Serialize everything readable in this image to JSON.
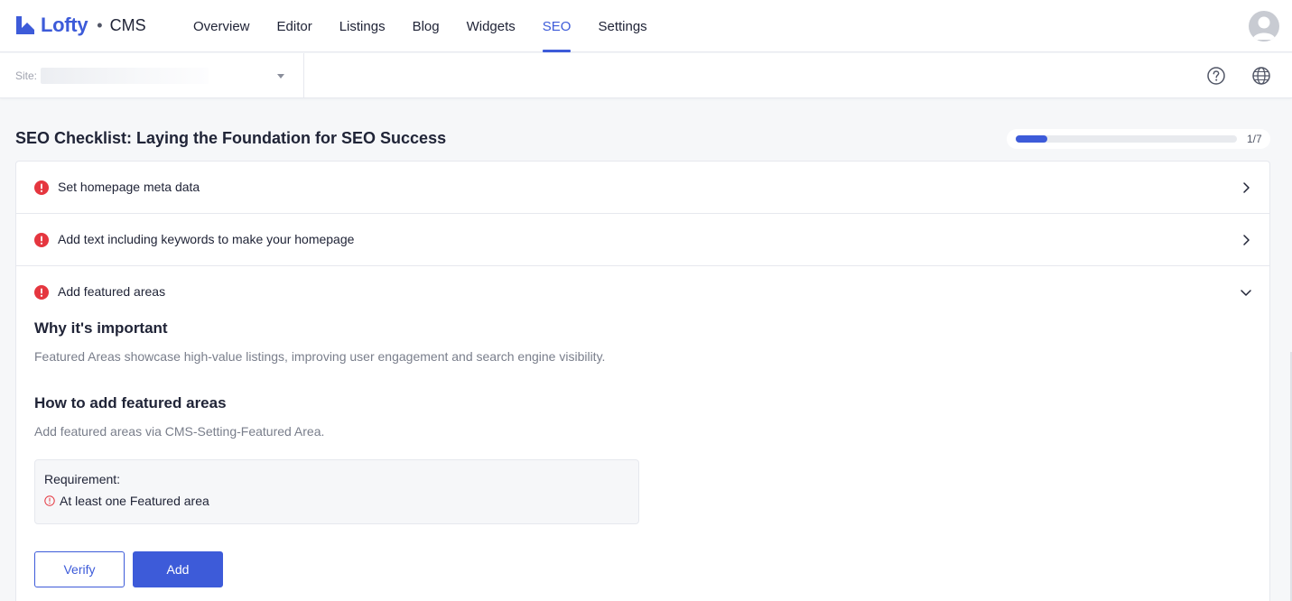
{
  "brand": {
    "name": "Lofty",
    "separator": "•",
    "product": "CMS",
    "color": "#3d5bd9"
  },
  "nav": {
    "tabs": [
      {
        "label": "Overview",
        "active": false
      },
      {
        "label": "Editor",
        "active": false
      },
      {
        "label": "Listings",
        "active": false
      },
      {
        "label": "Blog",
        "active": false
      },
      {
        "label": "Widgets",
        "active": false
      },
      {
        "label": "SEO",
        "active": true
      },
      {
        "label": "Settings",
        "active": false
      }
    ]
  },
  "site_bar": {
    "site_label": "Site:",
    "site_value": "",
    "help_icon": "help-circle-icon",
    "language_icon": "globe-icon"
  },
  "checklist": {
    "title": "SEO Checklist: Laying the Foundation for SEO Success",
    "progress_text": "1/7",
    "progress_fraction": 0.1429,
    "items": [
      {
        "label": "Set homepage meta data",
        "status": "error",
        "expanded": false
      },
      {
        "label": "Add text including keywords to make your homepage",
        "status": "error",
        "expanded": false
      },
      {
        "label": "Add featured areas",
        "status": "error",
        "expanded": true
      }
    ],
    "detail": {
      "why_heading": "Why it's important",
      "why_text": "Featured Areas showcase high-value listings, improving user engagement and search engine visibility.",
      "how_heading": "How to add featured areas",
      "how_text": "Add featured areas via CMS-Setting-Featured Area.",
      "requirement_title": "Requirement:",
      "requirement_item": "At least one Featured area",
      "verify_label": "Verify",
      "add_label": "Add"
    }
  },
  "colors": {
    "accent": "#3d5bd9",
    "error": "#e5363f",
    "muted_text": "#797e8b"
  }
}
